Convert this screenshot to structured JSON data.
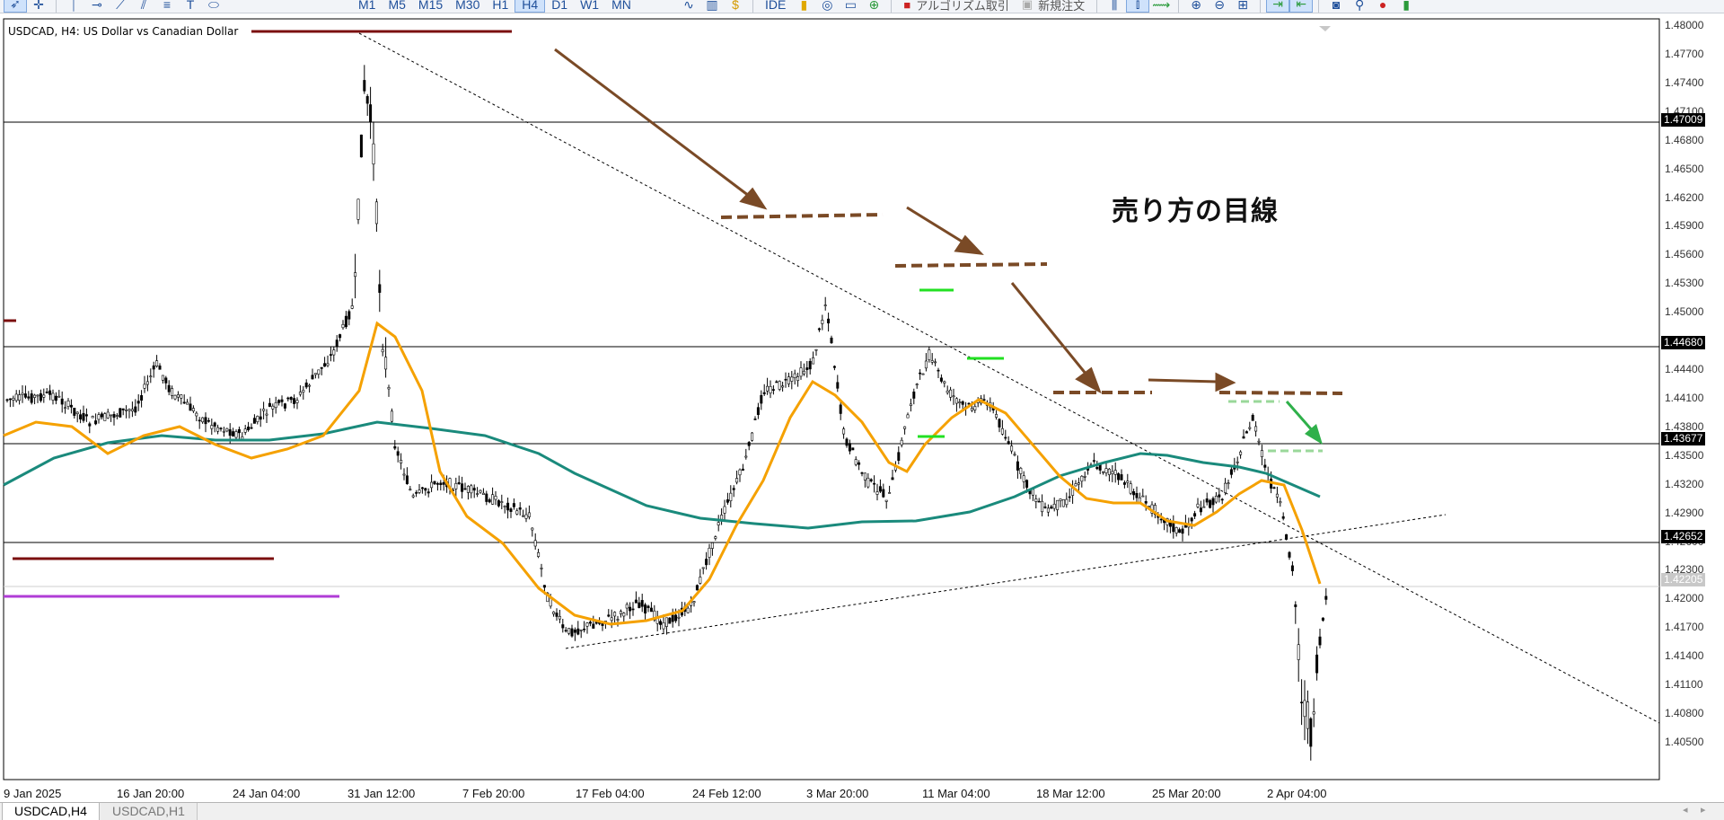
{
  "toolbar": {
    "timeframes": [
      "M1",
      "M5",
      "M15",
      "M30",
      "H1",
      "H4",
      "D1",
      "W1",
      "MN"
    ],
    "active_timeframe": "H4",
    "ide_label": "IDE",
    "algo_label": "アルゴリズム取引",
    "new_order_label": "新規注文"
  },
  "chart": {
    "symbol_label": "USDCAD, H4:  US Dollar vs Canadian Dollar",
    "annotation": "売り方の目線",
    "price_ticks": [
      "1.48000",
      "1.47700",
      "1.47400",
      "1.47100",
      "1.46800",
      "1.46500",
      "1.46200",
      "1.45900",
      "1.45600",
      "1.45300",
      "1.45000",
      "1.44700",
      "1.44400",
      "1.44100",
      "1.43800",
      "1.43500",
      "1.43200",
      "1.42900",
      "1.42600",
      "1.42300",
      "1.42000",
      "1.41700",
      "1.41400",
      "1.41100",
      "1.40800",
      "1.40500"
    ],
    "price_tags": [
      {
        "label": "1.47009",
        "style": "dark"
      },
      {
        "label": "1.44680",
        "style": "dark"
      },
      {
        "label": "1.43677",
        "style": "dark"
      },
      {
        "label": "1.42652",
        "style": "dark"
      },
      {
        "label": "1.42205",
        "style": "light"
      }
    ],
    "time_labels": [
      "9 Jan 2025",
      "16 Jan 20:00",
      "24 Jan 04:00",
      "31 Jan 12:00",
      "7 Feb 20:00",
      "17 Feb 04:00",
      "24 Feb 12:00",
      "3 Mar 20:00",
      "11 Mar 04:00",
      "18 Mar 12:00",
      "25 Mar 20:00",
      "2 Apr 04:00"
    ],
    "colors": {
      "ma_fast": "#f5a100",
      "ma_slow": "#1a8a7c",
      "candle": "#000000",
      "arrow_brown": "#7a4a26",
      "arrow_green": "#2fb04a",
      "dark_red_line": "#7b0f0f",
      "purple_line": "#b03cd6"
    }
  },
  "tabs": [
    {
      "label": "USDCAD,H4",
      "active": true
    },
    {
      "label": "USDCAD,H1",
      "active": false
    }
  ]
}
